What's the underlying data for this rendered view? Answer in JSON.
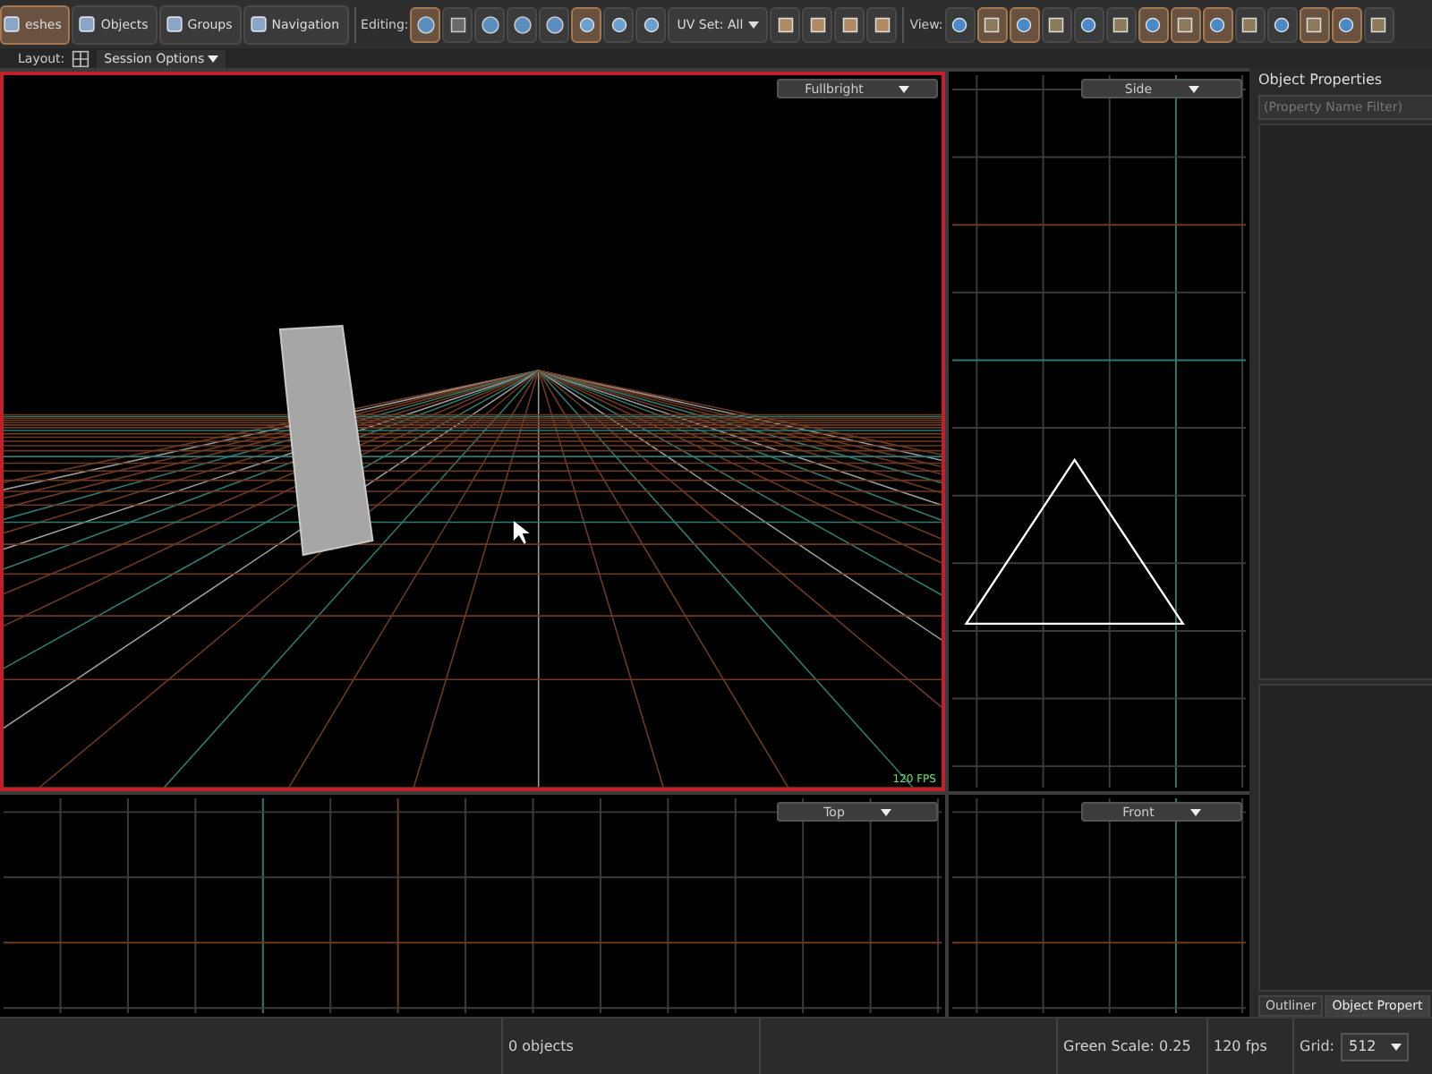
{
  "toolbar": {
    "tabs": [
      {
        "label": "eshes",
        "selected": true
      },
      {
        "label": "Objects",
        "selected": false
      },
      {
        "label": "Groups",
        "selected": false
      },
      {
        "label": "Navigation",
        "selected": false
      }
    ],
    "editing_label": "Editing:",
    "editing_tools": [
      {
        "selected": true
      },
      {
        "selected": false
      },
      {
        "selected": false
      },
      {
        "selected": false
      },
      {
        "selected": false
      }
    ],
    "selection_tools": [
      {
        "selected": true
      },
      {
        "selected": false
      },
      {
        "selected": false
      }
    ],
    "uv_set": "UV Set: All",
    "misc_tools": [
      {
        "selected": false
      },
      {
        "selected": false
      },
      {
        "selected": false
      },
      {
        "selected": false
      }
    ],
    "view_label": "View:",
    "view_toggles": [
      {
        "selected": false
      },
      {
        "selected": true
      },
      {
        "selected": true
      },
      {
        "selected": false
      },
      {
        "selected": false
      },
      {
        "selected": false
      },
      {
        "selected": true
      },
      {
        "selected": true
      },
      {
        "selected": true
      },
      {
        "selected": false
      },
      {
        "selected": false
      },
      {
        "selected": true
      },
      {
        "selected": true
      },
      {
        "selected": false
      }
    ]
  },
  "layout_bar": {
    "label": "Layout:",
    "session_options": "Session Options"
  },
  "viewports": [
    {
      "kind": "perspective",
      "mode": "Fullbright",
      "selected": true,
      "fps": "120 FPS"
    },
    {
      "kind": "side",
      "mode": "Side",
      "selected": false
    },
    {
      "kind": "top",
      "mode": "Top",
      "selected": false
    },
    {
      "kind": "front",
      "mode": "Front",
      "selected": false
    }
  ],
  "object_properties": {
    "title": "Object Properties",
    "filter_placeholder": "(Property Name Filter)",
    "tabs": [
      {
        "label": "Outliner",
        "selected": false
      },
      {
        "label": "Object Propert",
        "selected": true
      }
    ]
  },
  "status_bar": {
    "objects": "0 objects",
    "green_scale": "Green Scale: 0.25",
    "fps": "120 fps",
    "grid_label": "Grid:",
    "grid_value": "512"
  }
}
